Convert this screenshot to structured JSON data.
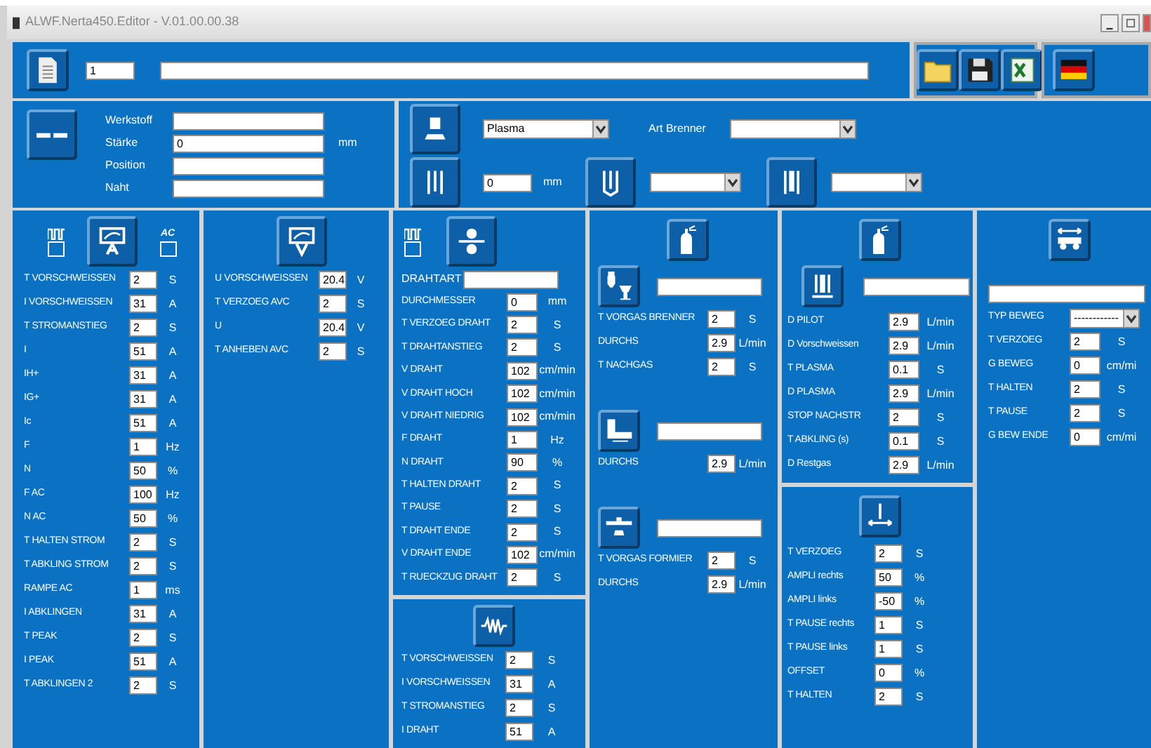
{
  "window": {
    "title": "ALWF.Nerta450.Editor - V.01.00.00.38"
  },
  "header": {
    "number": "1"
  },
  "job": {
    "fields": [
      {
        "label": "Werkstoff"
      },
      {
        "label": "Stärke",
        "value": "0",
        "unit": "mm"
      },
      {
        "label": "Position"
      },
      {
        "label": "Naht"
      }
    ]
  },
  "process": {
    "mode": "Plasma",
    "torch_label": "Art Brenner",
    "size": "0",
    "size_unit": "mm"
  },
  "current": {
    "toggles": [
      {
        "kind": "pulse",
        "checked": false
      },
      {
        "kind": "ac",
        "label": "AC",
        "checked": false
      }
    ],
    "rows": [
      {
        "label": "T VORSCHWEISSEN",
        "value": "2",
        "unit": "S"
      },
      {
        "label": "I VORSCHWEISSEN",
        "value": "31",
        "unit": "A"
      },
      {
        "label": "T STROMANSTIEG",
        "value": "2",
        "unit": "S"
      },
      {
        "label": "I",
        "value": "51",
        "unit": "A"
      },
      {
        "label": "IH+",
        "value": "31",
        "unit": "A"
      },
      {
        "label": "IG+",
        "value": "31",
        "unit": "A"
      },
      {
        "label": "Ic",
        "value": "51",
        "unit": "A"
      },
      {
        "label": "F",
        "value": "1",
        "unit": "Hz"
      },
      {
        "label": "N",
        "value": "50",
        "unit": "%"
      },
      {
        "label": "F AC",
        "value": "100",
        "unit": "Hz"
      },
      {
        "label": "N AC",
        "value": "50",
        "unit": "%"
      },
      {
        "label": "T HALTEN STROM",
        "value": "2",
        "unit": "S"
      },
      {
        "label": "T ABKLING STROM",
        "value": "2",
        "unit": "S"
      },
      {
        "label": "RAMPE AC",
        "value": "1",
        "unit": "ms"
      },
      {
        "label": "I ABKLINGEN",
        "value": "31",
        "unit": "A"
      },
      {
        "label": "T PEAK",
        "value": "2",
        "unit": "S"
      },
      {
        "label": "I PEAK",
        "value": "51",
        "unit": "A"
      },
      {
        "label": "T ABKLINGEN 2",
        "value": "2",
        "unit": "S"
      }
    ]
  },
  "voltage": {
    "rows": [
      {
        "label": "U VORSCHWEISSEN",
        "value": "20.4",
        "unit": "V"
      },
      {
        "label": "T VERZOEG AVC",
        "value": "2",
        "unit": "S"
      },
      {
        "label": "U",
        "value": "20.4",
        "unit": "V"
      },
      {
        "label": "T ANHEBEN AVC",
        "value": "2",
        "unit": "S"
      }
    ]
  },
  "wire": {
    "toggle": {
      "checked": false
    },
    "type_label": "DRAHTART",
    "rows": [
      {
        "label": "DURCHMESSER",
        "value": "0",
        "unit": "mm"
      },
      {
        "label": "T VERZOEG DRAHT",
        "value": "2",
        "unit": "S"
      },
      {
        "label": "T DRAHTANSTIEG",
        "value": "2",
        "unit": "S"
      },
      {
        "label": "V DRAHT",
        "value": "102",
        "unit": "cm/min"
      },
      {
        "label": "V DRAHT HOCH",
        "value": "102",
        "unit": "cm/min"
      },
      {
        "label": "V DRAHT NIEDRIG",
        "value": "102",
        "unit": "cm/min"
      },
      {
        "label": "F DRAHT",
        "value": "1",
        "unit": "Hz"
      },
      {
        "label": "N DRAHT",
        "value": "90",
        "unit": "%"
      },
      {
        "label": "T HALTEN DRAHT",
        "value": "2",
        "unit": "S"
      },
      {
        "label": "T PAUSE",
        "value": "2",
        "unit": "S"
      },
      {
        "label": "T DRAHT ENDE",
        "value": "2",
        "unit": "S"
      },
      {
        "label": "V DRAHT ENDE",
        "value": "102",
        "unit": "cm/min"
      },
      {
        "label": "T RUECKZUG DRAHT",
        "value": "2",
        "unit": "S"
      }
    ]
  },
  "pulse": {
    "rows": [
      {
        "label": "T VORSCHWEISSEN",
        "value": "2",
        "unit": "S"
      },
      {
        "label": "I VORSCHWEISSEN",
        "value": "31",
        "unit": "A"
      },
      {
        "label": "T STROMANSTIEG",
        "value": "2",
        "unit": "S"
      },
      {
        "label": "I DRAHT",
        "value": "51",
        "unit": "A"
      }
    ]
  },
  "gas": {
    "sections": [
      {
        "kind": "torch",
        "rows": [
          {
            "label": "T VORGAS BRENNER",
            "value": "2",
            "unit": "S"
          },
          {
            "label": "DURCHS",
            "value": "2.9",
            "unit": "L/min"
          },
          {
            "label": "T NACHGAS",
            "value": "2",
            "unit": "S"
          }
        ]
      },
      {
        "kind": "trailing",
        "rows": [
          {
            "label": "DURCHS",
            "value": "2.9",
            "unit": "L/min"
          }
        ]
      },
      {
        "kind": "backing",
        "rows": [
          {
            "label": "T VORGAS FORMIER",
            "value": "2",
            "unit": "S"
          },
          {
            "label": "DURCHS",
            "value": "2.9",
            "unit": "L/min"
          }
        ]
      }
    ]
  },
  "plasma": {
    "rows": [
      {
        "label": "D PILOT",
        "value": "2.9",
        "unit": "L/min"
      },
      {
        "label": "D Vorschweissen",
        "value": "2.9",
        "unit": "L/min"
      },
      {
        "label": "T PLASMA",
        "value": "0.1",
        "unit": "S"
      },
      {
        "label": "D PLASMA",
        "value": "2.9",
        "unit": "L/min"
      },
      {
        "label": "STOP NACHSTR",
        "value": "2",
        "unit": "S"
      },
      {
        "label": "T ABKLING (s)",
        "value": "0.1",
        "unit": "S"
      },
      {
        "label": "D Restgas",
        "value": "2.9",
        "unit": "L/min"
      }
    ]
  },
  "oscillation": {
    "rows": [
      {
        "label": "T VERZOEG",
        "value": "2",
        "unit": "S"
      },
      {
        "label": "AMPLI rechts",
        "value": "50",
        "unit": "%"
      },
      {
        "label": "AMPLI links",
        "value": "-50",
        "unit": "%"
      },
      {
        "label": "T PAUSE rechts",
        "value": "1",
        "unit": "S"
      },
      {
        "label": "T PAUSE links",
        "value": "1",
        "unit": "S"
      },
      {
        "label": "OFFSET",
        "value": "0",
        "unit": "%"
      },
      {
        "label": "T HALTEN",
        "value": "2",
        "unit": "S"
      }
    ]
  },
  "travel": {
    "rows": [
      {
        "kind": "select",
        "label": "TYP BEWEG",
        "value": "------------"
      },
      {
        "kind": "field",
        "label": "T VERZOEG",
        "value": "2",
        "unit": "S"
      },
      {
        "kind": "field",
        "label": "G BEWEG",
        "value": "0",
        "unit": "cm/mi"
      },
      {
        "kind": "field",
        "label": "T HALTEN",
        "value": "2",
        "unit": "S"
      },
      {
        "kind": "field",
        "label": "T PAUSE",
        "value": "2",
        "unit": "S"
      },
      {
        "kind": "field",
        "label": "G BEW ENDE",
        "value": "0",
        "unit": "cm/mi"
      }
    ]
  }
}
